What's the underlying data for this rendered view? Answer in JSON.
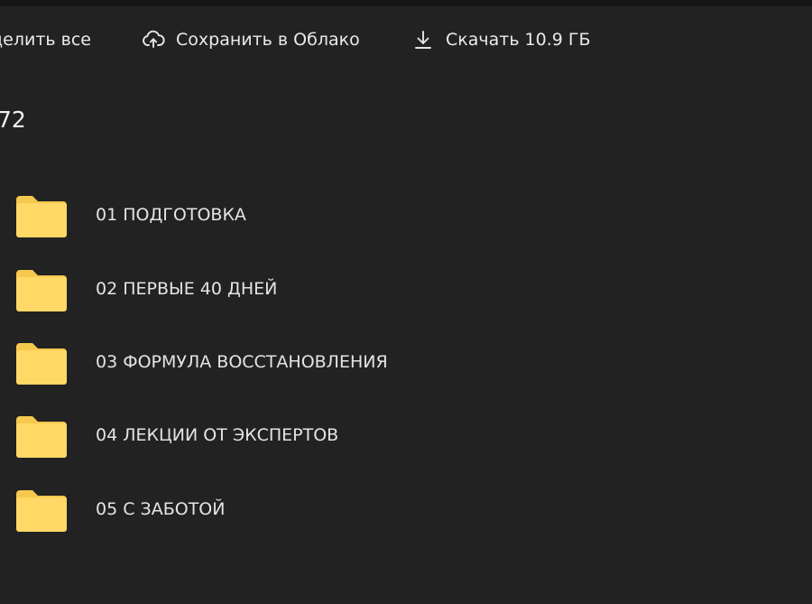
{
  "toolbar": {
    "select_all_label": "делить все",
    "save_label": "Сохранить в Облако",
    "download_label": "Скачать 10.9 ГБ"
  },
  "summary": {
    "count": "72"
  },
  "folders": [
    {
      "name": "01 ПОДГОТОВКА",
      "icon": "folder-icon"
    },
    {
      "name": "02 ПЕРВЫЕ 40 ДНЕЙ",
      "icon": "folder-icon"
    },
    {
      "name": "03 ФОРМУЛА ВОССТАНОВЛЕНИЯ",
      "icon": "folder-icon"
    },
    {
      "name": "04 ЛЕКЦИИ ОТ ЭКСПЕРТОВ",
      "icon": "folder-icon"
    },
    {
      "name": "05 С ЗАБОТОЙ",
      "icon": "folder-icon"
    }
  ],
  "colors": {
    "background": "#222222",
    "folder": "#ffd866",
    "folder_tab": "#f5c94e",
    "text": "#e8e8e8"
  }
}
